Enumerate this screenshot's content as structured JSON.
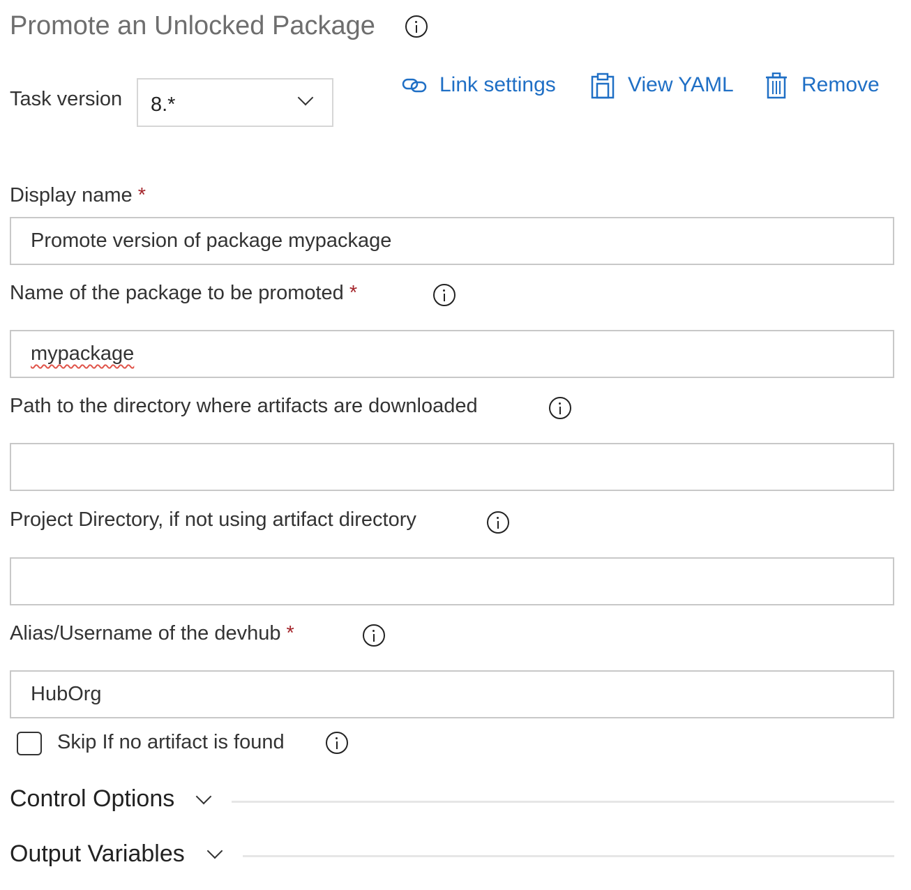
{
  "header": {
    "title": "Promote an Unlocked Package"
  },
  "task_version": {
    "label": "Task version",
    "selected": "8.*"
  },
  "actions": {
    "link_settings": "Link settings",
    "view_yaml": "View YAML",
    "remove": "Remove"
  },
  "fields": {
    "display_name": {
      "label": "Display name",
      "required": "*",
      "value": "Promote version of package mypackage"
    },
    "package_name": {
      "label": "Name of the package to be promoted",
      "required": "*",
      "value": "mypackage"
    },
    "artifact_dir": {
      "label": "Path to the directory where artifacts are downloaded",
      "value": ""
    },
    "project_dir": {
      "label": "Project Directory, if not using artifact directory",
      "value": ""
    },
    "devhub_alias": {
      "label": "Alias/Username of the devhub",
      "required": "*",
      "value": "HubOrg"
    }
  },
  "skip_checkbox": {
    "label": "Skip If no artifact is found",
    "checked": false
  },
  "sections": {
    "control_options": "Control Options",
    "output_variables": "Output Variables"
  },
  "colors": {
    "accent": "#1f6fc5",
    "required": "#a4262c"
  }
}
